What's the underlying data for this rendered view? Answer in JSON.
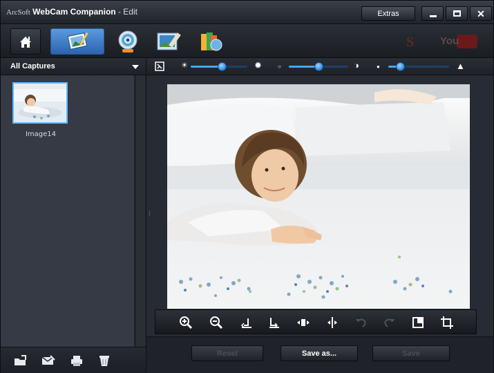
{
  "titlebar": {
    "brand": "ArcSoft",
    "app_name": "WebCam Companion",
    "mode": " - Edit",
    "extras_label": "Extras",
    "close_label": "✕"
  },
  "nav": {
    "items": [
      "home-icon",
      "edit-icon",
      "webcam-icon",
      "frame-icon",
      "share-icon"
    ],
    "youtube_label": "You"
  },
  "captures": {
    "dropdown_label": "All Captures",
    "items": [
      {
        "label": "Image14"
      }
    ]
  },
  "adjustments": {
    "brightness_level": 0.55,
    "contrast_level": 0.5,
    "sharpness_level": 0.2
  },
  "edit_tools": [
    "zoom-in-icon",
    "zoom-out-icon",
    "rotate-left-icon",
    "rotate-right-icon",
    "flip-vertical-icon",
    "flip-horizontal-icon",
    "undo-icon",
    "redo-icon",
    "fit-to-window-icon",
    "crop-icon"
  ],
  "actions": {
    "reset_label": "Reset",
    "save_as_label": "Save as...",
    "save_label": "Save"
  },
  "colors": {
    "accent": "#3d82d6",
    "background": "#1d2026",
    "panel": "#353a44"
  }
}
